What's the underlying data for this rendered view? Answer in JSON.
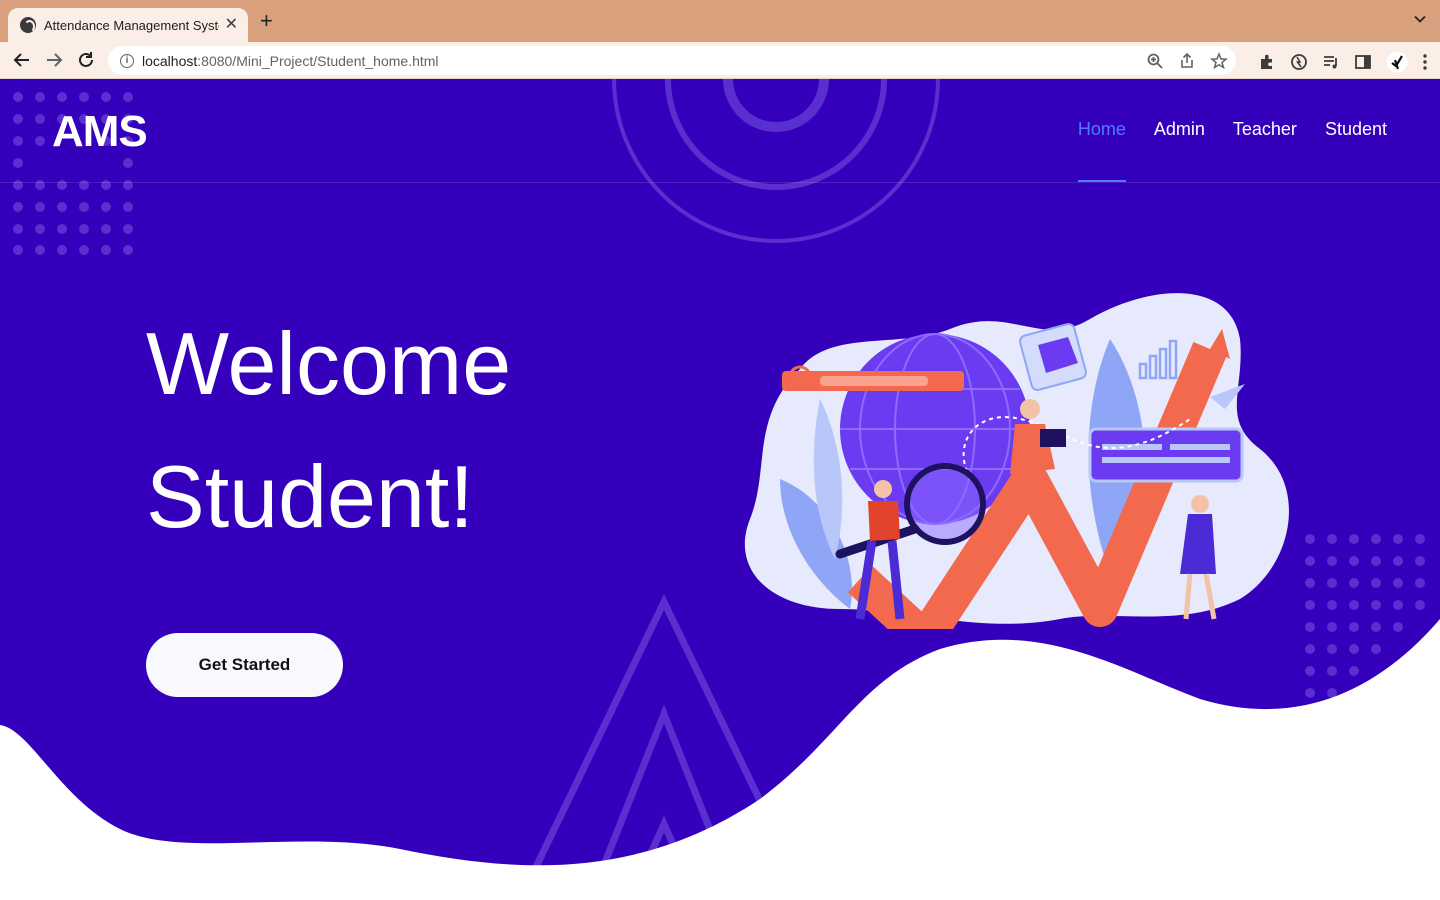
{
  "browser": {
    "tab_title": "Attendance Management System",
    "new_tab": "+",
    "tab_close": "✕",
    "url_host": "localhost",
    "url_path": ":8080/Mini_Project/Student_home.html"
  },
  "site": {
    "logo": "AMS",
    "nav": [
      {
        "label": "Home",
        "active": true
      },
      {
        "label": "Admin",
        "active": false
      },
      {
        "label": "Teacher",
        "active": false
      },
      {
        "label": "Student",
        "active": false
      }
    ]
  },
  "hero": {
    "line1": "Welcome",
    "line2": "Student!",
    "cta_label": "Get Started"
  },
  "colors": {
    "page_bg": "#3500bb",
    "nav_active": "#4f7bff",
    "tabbar": "#d9a07d",
    "toolbar": "#fbeee6"
  },
  "icons": [
    "back-icon",
    "forward-icon",
    "reload-icon",
    "info-icon",
    "zoom-icon",
    "share-icon",
    "star-icon",
    "extensions-icon",
    "sync-icon",
    "media-icon",
    "sidepanel-icon",
    "profile-avatar",
    "menu-icon",
    "tab-list-icon"
  ]
}
